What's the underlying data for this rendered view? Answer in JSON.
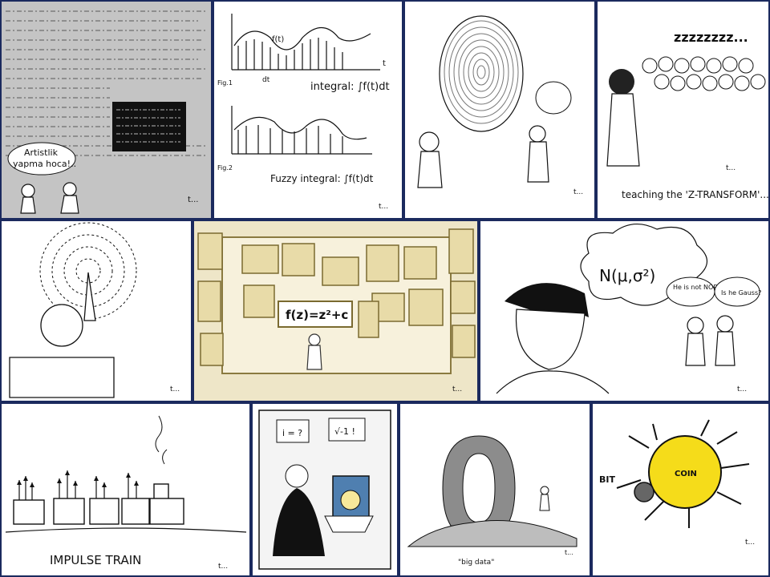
{
  "panels": {
    "blackboard": {
      "bubble_line1": "Artistlik",
      "bubble_line2": "yapma hoca!..",
      "signature": "t..."
    },
    "integral": {
      "fig1": "Fig.1",
      "fig2": "Fig.2",
      "ft": "f(t)",
      "dt": "dt",
      "t_axis": "t",
      "integral_label": "integral: ∫f(t)dt",
      "fuzzy_label": "Fuzzy integral: ∫f(t)dt",
      "signature": "t..."
    },
    "fingerprint": {
      "signature": "t..."
    },
    "ztransform": {
      "zzz": "zzzzzzzz...",
      "caption": "teaching the 'Z-TRANSFORM'...",
      "signature": "t..."
    },
    "idea": {
      "signature": "t..."
    },
    "gallery": {
      "formula": "f(z)=z²+c",
      "signature": "t..."
    },
    "gauss": {
      "thought": "N(μ,σ²)",
      "bubble_left": "He is not NORMAL !",
      "bubble_right": "Is he Gauss?",
      "signature": "t..."
    },
    "impulse": {
      "caption": "IMPULSE TRAIN",
      "signature": "t..."
    },
    "mirror": {
      "bubble_left": "i = ?",
      "bubble_right": "√-1 !"
    },
    "bigdata": {
      "caption": "\"big data\"",
      "signature": "t..."
    },
    "bit": {
      "coin": "COIN",
      "bit": "BIT",
      "signature": "t..."
    }
  }
}
